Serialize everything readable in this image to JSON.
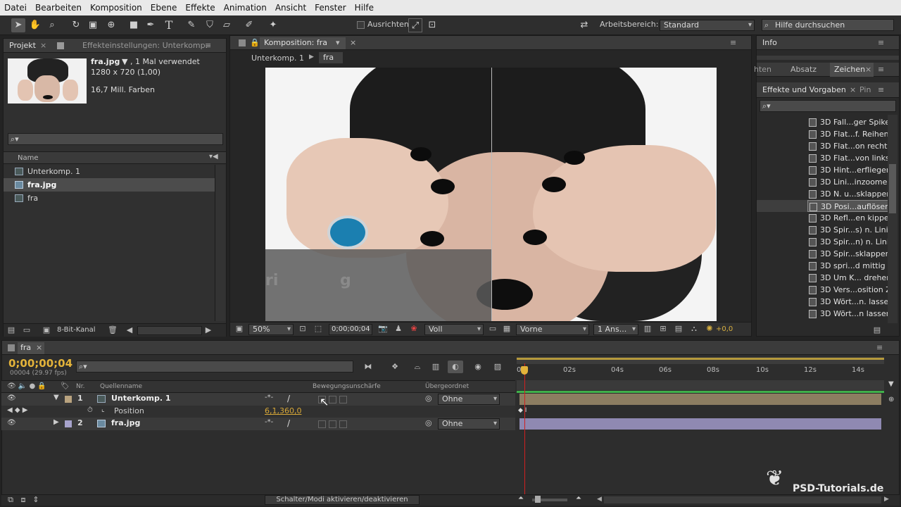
{
  "menu": [
    "Datei",
    "Bearbeiten",
    "Komposition",
    "Ebene",
    "Effekte",
    "Animation",
    "Ansicht",
    "Fenster",
    "Hilfe"
  ],
  "toolbar": {
    "align_label": "Ausrichten",
    "workspace_label": "Arbeitsbereich:",
    "workspace_value": "Standard",
    "help_placeholder": "Hilfe durchsuchen"
  },
  "project": {
    "tab_project": "Projekt",
    "tab_effects": "Effekteinstellungen: Unterkomp.",
    "file_name": "fra.jpg",
    "file_usage": "▼ , 1 Mal verwendet",
    "file_dims": "1280 x 720 (1,00)",
    "file_colors": "16,7 Mill. Farben",
    "col_name": "Name",
    "items": [
      {
        "label": "Unterkomp. 1"
      },
      {
        "label": "fra.jpg"
      },
      {
        "label": "fra"
      }
    ],
    "bit_depth": "8-Bit-Kanal"
  },
  "comp": {
    "tab_title": "Komposition: fra",
    "breadcrumb_1": "Unterkomp. 1",
    "breadcrumb_2": "fra",
    "zoom": "50%",
    "timecode": "0;00;00;04",
    "resolution": "Voll",
    "view": "Vorne",
    "views": "1 Ans...",
    "exposure": "+0,0"
  },
  "right": {
    "info": "Info",
    "tab_a": "hten",
    "tab_b": "Absatz",
    "tab_c": "Zeichen",
    "effects_title": "Effekte und Vorgaben",
    "tab_d": "Pin",
    "effects": [
      "3D Fall...ger Spikes",
      "3D Flat...f. Reihenf",
      "3D Flat...on rechts",
      "3D Flat...von links",
      "3D Hint...erfliegen",
      "3D Lini...inzoomen",
      "3D N. u...sklappen",
      "3D Posi...auflösen",
      "3D Refl...en kippen",
      "3D Spir...s) n. Linie",
      "3D Spir...n) n. Linie",
      "3D Spir...sklappen",
      "3D spri...d mittig",
      "3D Um K... drehen",
      "3D Vers...osition Z",
      "3D Wört...n. lassen",
      "3D Wört...n lassen"
    ]
  },
  "timeline": {
    "tab": "fra",
    "timecode": "0;00;00;04",
    "frames": "00004 (29.97 fps)",
    "col_nr": "Nr.",
    "col_source": "Quellenname",
    "col_motion": "Bewegungsunschärfe",
    "col_parent": "Übergeordnet",
    "layers": [
      {
        "nr": "1",
        "name": "Unterkomp. 1",
        "parent": "Ohne"
      },
      {
        "nr": "2",
        "name": "fra.jpg",
        "parent": "Ohne"
      }
    ],
    "position_label": "Position",
    "position_value": "6,1,360,0",
    "ruler": [
      "02s",
      "04s",
      "06s",
      "08s",
      "10s",
      "12s",
      "14s"
    ],
    "toggle_label": "Schalter/Modi aktivieren/deaktivieren",
    "watermark": "PSD-Tutorials.de"
  }
}
